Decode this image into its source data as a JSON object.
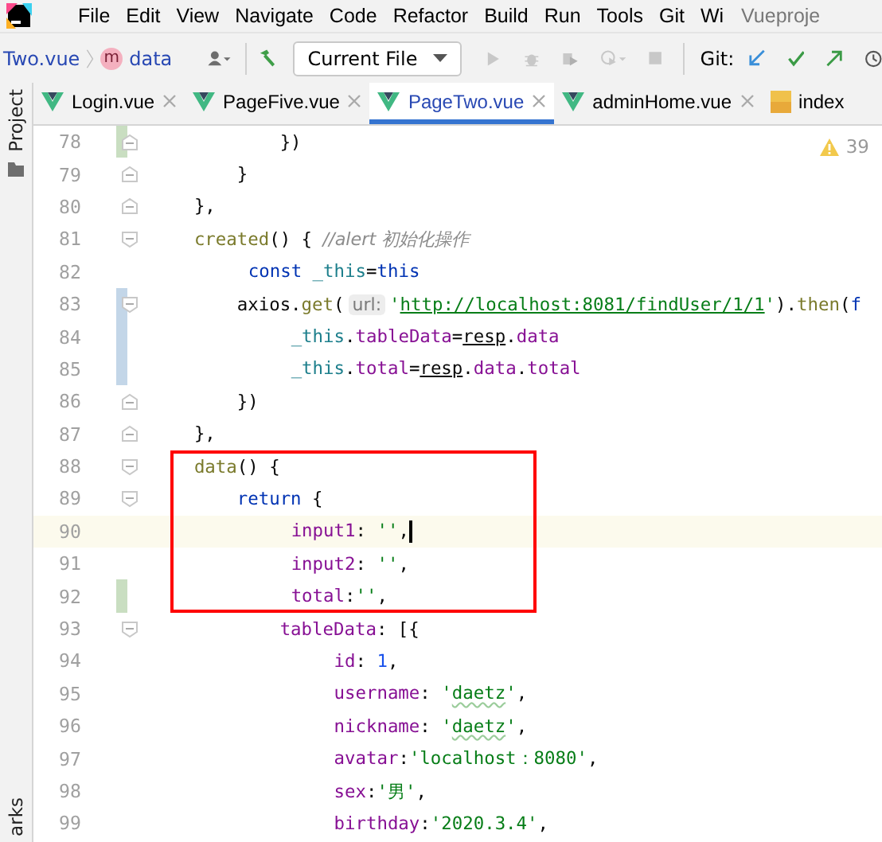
{
  "menu": {
    "items": [
      "File",
      "Edit",
      "View",
      "Navigate",
      "Code",
      "Refactor",
      "Build",
      "Run",
      "Tools",
      "Git",
      "Wi"
    ],
    "project_title": "Vueproje"
  },
  "toolbar": {
    "breadcrumb": [
      {
        "kind": "file",
        "text": "Two.vue"
      },
      {
        "kind": "method",
        "badge": "m",
        "text": "data"
      }
    ],
    "run_config": "Current File",
    "git_label": "Git:"
  },
  "tabs": [
    {
      "label": "Login.vue",
      "kind": "vue",
      "selected": false,
      "closable": true
    },
    {
      "label": "PageFive.vue",
      "kind": "vue",
      "selected": false,
      "closable": true
    },
    {
      "label": "PageTwo.vue",
      "kind": "vue",
      "selected": true,
      "closable": true
    },
    {
      "label": "adminHome.vue",
      "kind": "vue",
      "selected": false,
      "closable": true
    },
    {
      "label": "index",
      "kind": "js",
      "selected": false,
      "closable": false
    }
  ],
  "side_strip": {
    "top_label": "Project",
    "bottom_label": "arks"
  },
  "editor": {
    "warnings": "39",
    "lines": [
      {
        "number": "78",
        "fold": {
          "kind": "end"
        },
        "change": {
          "color": "#c9dec1"
        },
        "current": false,
        "boxed": false,
        "tokens": [
          {
            "t": "            })",
            "kind": "plain"
          }
        ]
      },
      {
        "number": "79",
        "fold": {
          "kind": "end"
        },
        "current": false,
        "boxed": false,
        "tokens": [
          {
            "t": "        }",
            "kind": "plain"
          }
        ]
      },
      {
        "number": "80",
        "fold": {
          "kind": "end"
        },
        "current": false,
        "boxed": false,
        "tokens": [
          {
            "t": "    },",
            "kind": "plain"
          }
        ]
      },
      {
        "number": "81",
        "fold": {
          "kind": "start"
        },
        "current": false,
        "boxed": false,
        "tokens": [
          {
            "t": "    created",
            "kind": "func"
          },
          {
            "t": "() { ",
            "kind": "plain"
          },
          {
            "t": "//alert 初始化操作",
            "kind": "comment"
          }
        ]
      },
      {
        "number": "82",
        "current": false,
        "boxed": false,
        "tokens": [
          {
            "t": "        const ",
            "kind": "keyword"
          },
          {
            "t": "_this",
            "kind": "local"
          },
          {
            "t": "=",
            "kind": "plain"
          },
          {
            "t": "this",
            "kind": "keyword"
          }
        ]
      },
      {
        "number": "83",
        "fold": {
          "kind": "start"
        },
        "change": {
          "color": "#c3d6e8"
        },
        "current": false,
        "boxed": false,
        "tokens": [
          {
            "t": "        axios.",
            "kind": "plain"
          },
          {
            "t": "get",
            "kind": "func"
          },
          {
            "t": "(",
            "kind": "plain"
          },
          {
            "t": "url:",
            "kind": "hint"
          },
          {
            "t": "'",
            "kind": "string"
          },
          {
            "t": "http://localhost:8081/findUser/1/1",
            "kind": "link"
          },
          {
            "t": "'",
            "kind": "string"
          },
          {
            "t": ").",
            "kind": "plain"
          },
          {
            "t": "then",
            "kind": "func"
          },
          {
            "t": "(",
            "kind": "plain"
          },
          {
            "t": "f",
            "kind": "keyword"
          }
        ]
      },
      {
        "number": "84",
        "change": {
          "color": "#c3d6e8"
        },
        "current": false,
        "boxed": false,
        "tokens": [
          {
            "t": "            _this",
            "kind": "local"
          },
          {
            "t": ".",
            "kind": "plain"
          },
          {
            "t": "tableData",
            "kind": "field"
          },
          {
            "t": "=",
            "kind": "plain"
          },
          {
            "t": "resp",
            "kind": "ref"
          },
          {
            "t": ".",
            "kind": "plain"
          },
          {
            "t": "data",
            "kind": "field"
          }
        ]
      },
      {
        "number": "85",
        "change": {
          "color": "#c3d6e8"
        },
        "current": false,
        "boxed": false,
        "tokens": [
          {
            "t": "            _this",
            "kind": "local"
          },
          {
            "t": ".",
            "kind": "plain"
          },
          {
            "t": "total",
            "kind": "field"
          },
          {
            "t": "=",
            "kind": "plain"
          },
          {
            "t": "resp",
            "kind": "ref"
          },
          {
            "t": ".",
            "kind": "plain"
          },
          {
            "t": "data",
            "kind": "field"
          },
          {
            "t": ".",
            "kind": "plain"
          },
          {
            "t": "total",
            "kind": "field"
          }
        ]
      },
      {
        "number": "86",
        "fold": {
          "kind": "end"
        },
        "current": false,
        "boxed": false,
        "tokens": [
          {
            "t": "        })",
            "kind": "plain"
          }
        ]
      },
      {
        "number": "87",
        "fold": {
          "kind": "end"
        },
        "current": false,
        "boxed": false,
        "tokens": [
          {
            "t": "    },",
            "kind": "plain"
          }
        ]
      },
      {
        "number": "88",
        "fold": {
          "kind": "start"
        },
        "current": false,
        "boxed": true,
        "tokens": [
          {
            "t": "    data",
            "kind": "func"
          },
          {
            "t": "() {",
            "kind": "plain"
          }
        ]
      },
      {
        "number": "89",
        "fold": {
          "kind": "start"
        },
        "current": false,
        "boxed": true,
        "tokens": [
          {
            "t": "        return ",
            "kind": "keyword"
          },
          {
            "t": "{",
            "kind": "plain"
          }
        ]
      },
      {
        "number": "90",
        "current": true,
        "boxed": true,
        "tokens": [
          {
            "t": "            input1",
            "kind": "field"
          },
          {
            "t": ": ",
            "kind": "plain"
          },
          {
            "t": "''",
            "kind": "string"
          },
          {
            "t": ",",
            "kind": "plain"
          }
        ]
      },
      {
        "number": "91",
        "current": false,
        "boxed": true,
        "tokens": [
          {
            "t": "            input2",
            "kind": "field"
          },
          {
            "t": ": ",
            "kind": "plain"
          },
          {
            "t": "''",
            "kind": "string"
          },
          {
            "t": ",",
            "kind": "plain"
          }
        ]
      },
      {
        "number": "92",
        "change": {
          "color": "#c9dec1"
        },
        "current": false,
        "boxed": true,
        "tokens": [
          {
            "t": "            total",
            "kind": "field"
          },
          {
            "t": ":",
            "kind": "plain"
          },
          {
            "t": "''",
            "kind": "string"
          },
          {
            "t": ",",
            "kind": "plain"
          }
        ]
      },
      {
        "number": "93",
        "fold": {
          "kind": "start"
        },
        "current": false,
        "boxed": false,
        "tokens": [
          {
            "t": "            tableData",
            "kind": "field"
          },
          {
            "t": ": [{",
            "kind": "plain"
          }
        ]
      },
      {
        "number": "94",
        "current": false,
        "boxed": false,
        "tokens": [
          {
            "t": "                id",
            "kind": "field"
          },
          {
            "t": ": ",
            "kind": "plain"
          },
          {
            "t": "1",
            "kind": "number"
          },
          {
            "t": ",",
            "kind": "plain"
          }
        ]
      },
      {
        "number": "95",
        "current": false,
        "boxed": false,
        "tokens": [
          {
            "t": "                username",
            "kind": "field"
          },
          {
            "t": ": ",
            "kind": "plain"
          },
          {
            "t": "'",
            "kind": "string"
          },
          {
            "t": "daetz",
            "kind": "typo"
          },
          {
            "t": "'",
            "kind": "string"
          },
          {
            "t": ",",
            "kind": "plain"
          }
        ]
      },
      {
        "number": "96",
        "current": false,
        "boxed": false,
        "tokens": [
          {
            "t": "                nickname",
            "kind": "field"
          },
          {
            "t": ": ",
            "kind": "plain"
          },
          {
            "t": "'",
            "kind": "string"
          },
          {
            "t": "daetz",
            "kind": "typo"
          },
          {
            "t": "'",
            "kind": "string"
          },
          {
            "t": ",",
            "kind": "plain"
          }
        ]
      },
      {
        "number": "97",
        "current": false,
        "boxed": false,
        "tokens": [
          {
            "t": "                avatar",
            "kind": "field"
          },
          {
            "t": ":",
            "kind": "plain"
          },
          {
            "t": "'localhost：8080'",
            "kind": "string"
          },
          {
            "t": ",",
            "kind": "plain"
          }
        ]
      },
      {
        "number": "98",
        "current": false,
        "boxed": false,
        "tokens": [
          {
            "t": "                sex",
            "kind": "field"
          },
          {
            "t": ":",
            "kind": "plain"
          },
          {
            "t": "'男'",
            "kind": "string"
          },
          {
            "t": ",",
            "kind": "plain"
          }
        ]
      },
      {
        "number": "99",
        "current": false,
        "boxed": false,
        "tokens": [
          {
            "t": "                birthday",
            "kind": "field"
          },
          {
            "t": ":",
            "kind": "plain"
          },
          {
            "t": "'2020.3.4'",
            "kind": "string"
          },
          {
            "t": ",",
            "kind": "plain"
          }
        ]
      }
    ]
  }
}
